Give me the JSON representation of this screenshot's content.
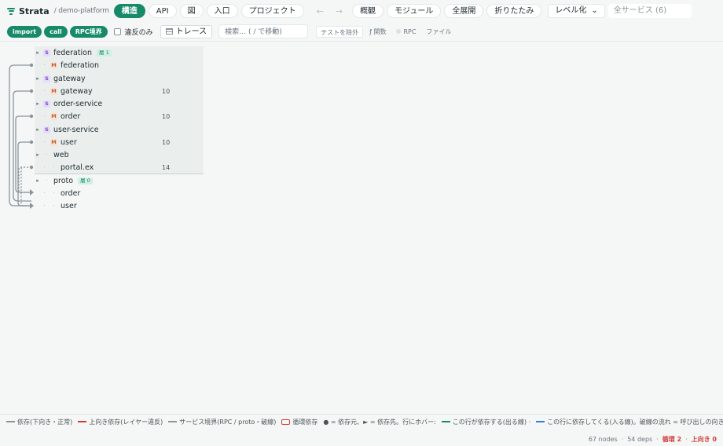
{
  "header": {
    "brand": "Strata",
    "project": "/ demo-platform",
    "view_tabs": [
      {
        "label": "構造",
        "active": true
      },
      {
        "label": "API",
        "active": false
      },
      {
        "label": "図",
        "active": false
      },
      {
        "label": "入口",
        "active": false
      },
      {
        "label": "プロジェクト",
        "active": false
      }
    ],
    "back_arrow": "←",
    "forward_arrow": "→",
    "mode_buttons": [
      "概観",
      "モジュール",
      "全展開",
      "折りたたみ"
    ],
    "layout_select": {
      "value": "レベル化",
      "chevron": "⌄"
    },
    "service_filter_placeholder": "全サービス (6)"
  },
  "filterbar": {
    "chips": [
      "import",
      "call",
      "RPC境界"
    ],
    "violations_only": {
      "label": "違反のみ",
      "checked": false
    },
    "trace_label": "トレース",
    "search_placeholder": "検索… ( / で移動)",
    "exclude_tests": "テストを除外",
    "function_label": "ƒ 関数",
    "rpc_label": "RPC",
    "file_label": "ファイル"
  },
  "tree": {
    "rows": [
      {
        "kind": "service",
        "badge": "S",
        "label": "federation",
        "tag": "層 1",
        "count": ""
      },
      {
        "kind": "module",
        "badge": "M",
        "label": "federation",
        "count": ""
      },
      {
        "kind": "service",
        "badge": "S",
        "label": "gateway",
        "count": ""
      },
      {
        "kind": "module",
        "badge": "M",
        "label": "gateway",
        "count": "10"
      },
      {
        "kind": "service",
        "badge": "S",
        "label": "order-service",
        "count": ""
      },
      {
        "kind": "module",
        "badge": "M",
        "label": "order",
        "count": "10"
      },
      {
        "kind": "service",
        "badge": "S",
        "label": "user-service",
        "count": ""
      },
      {
        "kind": "module",
        "badge": "M",
        "label": "user",
        "count": "10"
      },
      {
        "kind": "group",
        "badge": "·",
        "label": "web",
        "count": ""
      },
      {
        "kind": "file",
        "badge": "·",
        "label": "portal.ex",
        "count": "14"
      },
      {
        "kind": "group",
        "badge": "·",
        "label": "proto",
        "tag": "層 0",
        "count": ""
      },
      {
        "kind": "file",
        "badge": "·",
        "label": "order",
        "count": ""
      },
      {
        "kind": "file",
        "badge": "·",
        "label": "user",
        "count": ""
      }
    ]
  },
  "legend": {
    "items": [
      {
        "label": "依存(下向き・正常)",
        "color": "#8a949a"
      },
      {
        "label": "上向き依存(レイヤー違反)",
        "color": "#d23c3c"
      },
      {
        "label": "サービス境界(RPC / proto・破線)",
        "color": "#8a949a"
      },
      {
        "label": "循環依存",
        "color": "#d23c3c"
      },
      {
        "label": "● = 依存元、► = 依存先。行にホバー:",
        "color": ""
      },
      {
        "label": "この行が依存する(出る線) ·",
        "color": "#178a6a"
      },
      {
        "label": "この行に依存してくる(入る線)。破線の流れ = 呼び出しの向き",
        "color": "#2f7fd8"
      }
    ]
  },
  "status": {
    "nodes": "67 nodes",
    "deps": "54 deps",
    "cycles": "循環 2",
    "upward": "上向き 0",
    "separator": "·"
  },
  "colors": {
    "accent": "#178a6a",
    "danger": "#d23c3c",
    "incoming": "#2f7fd8"
  }
}
